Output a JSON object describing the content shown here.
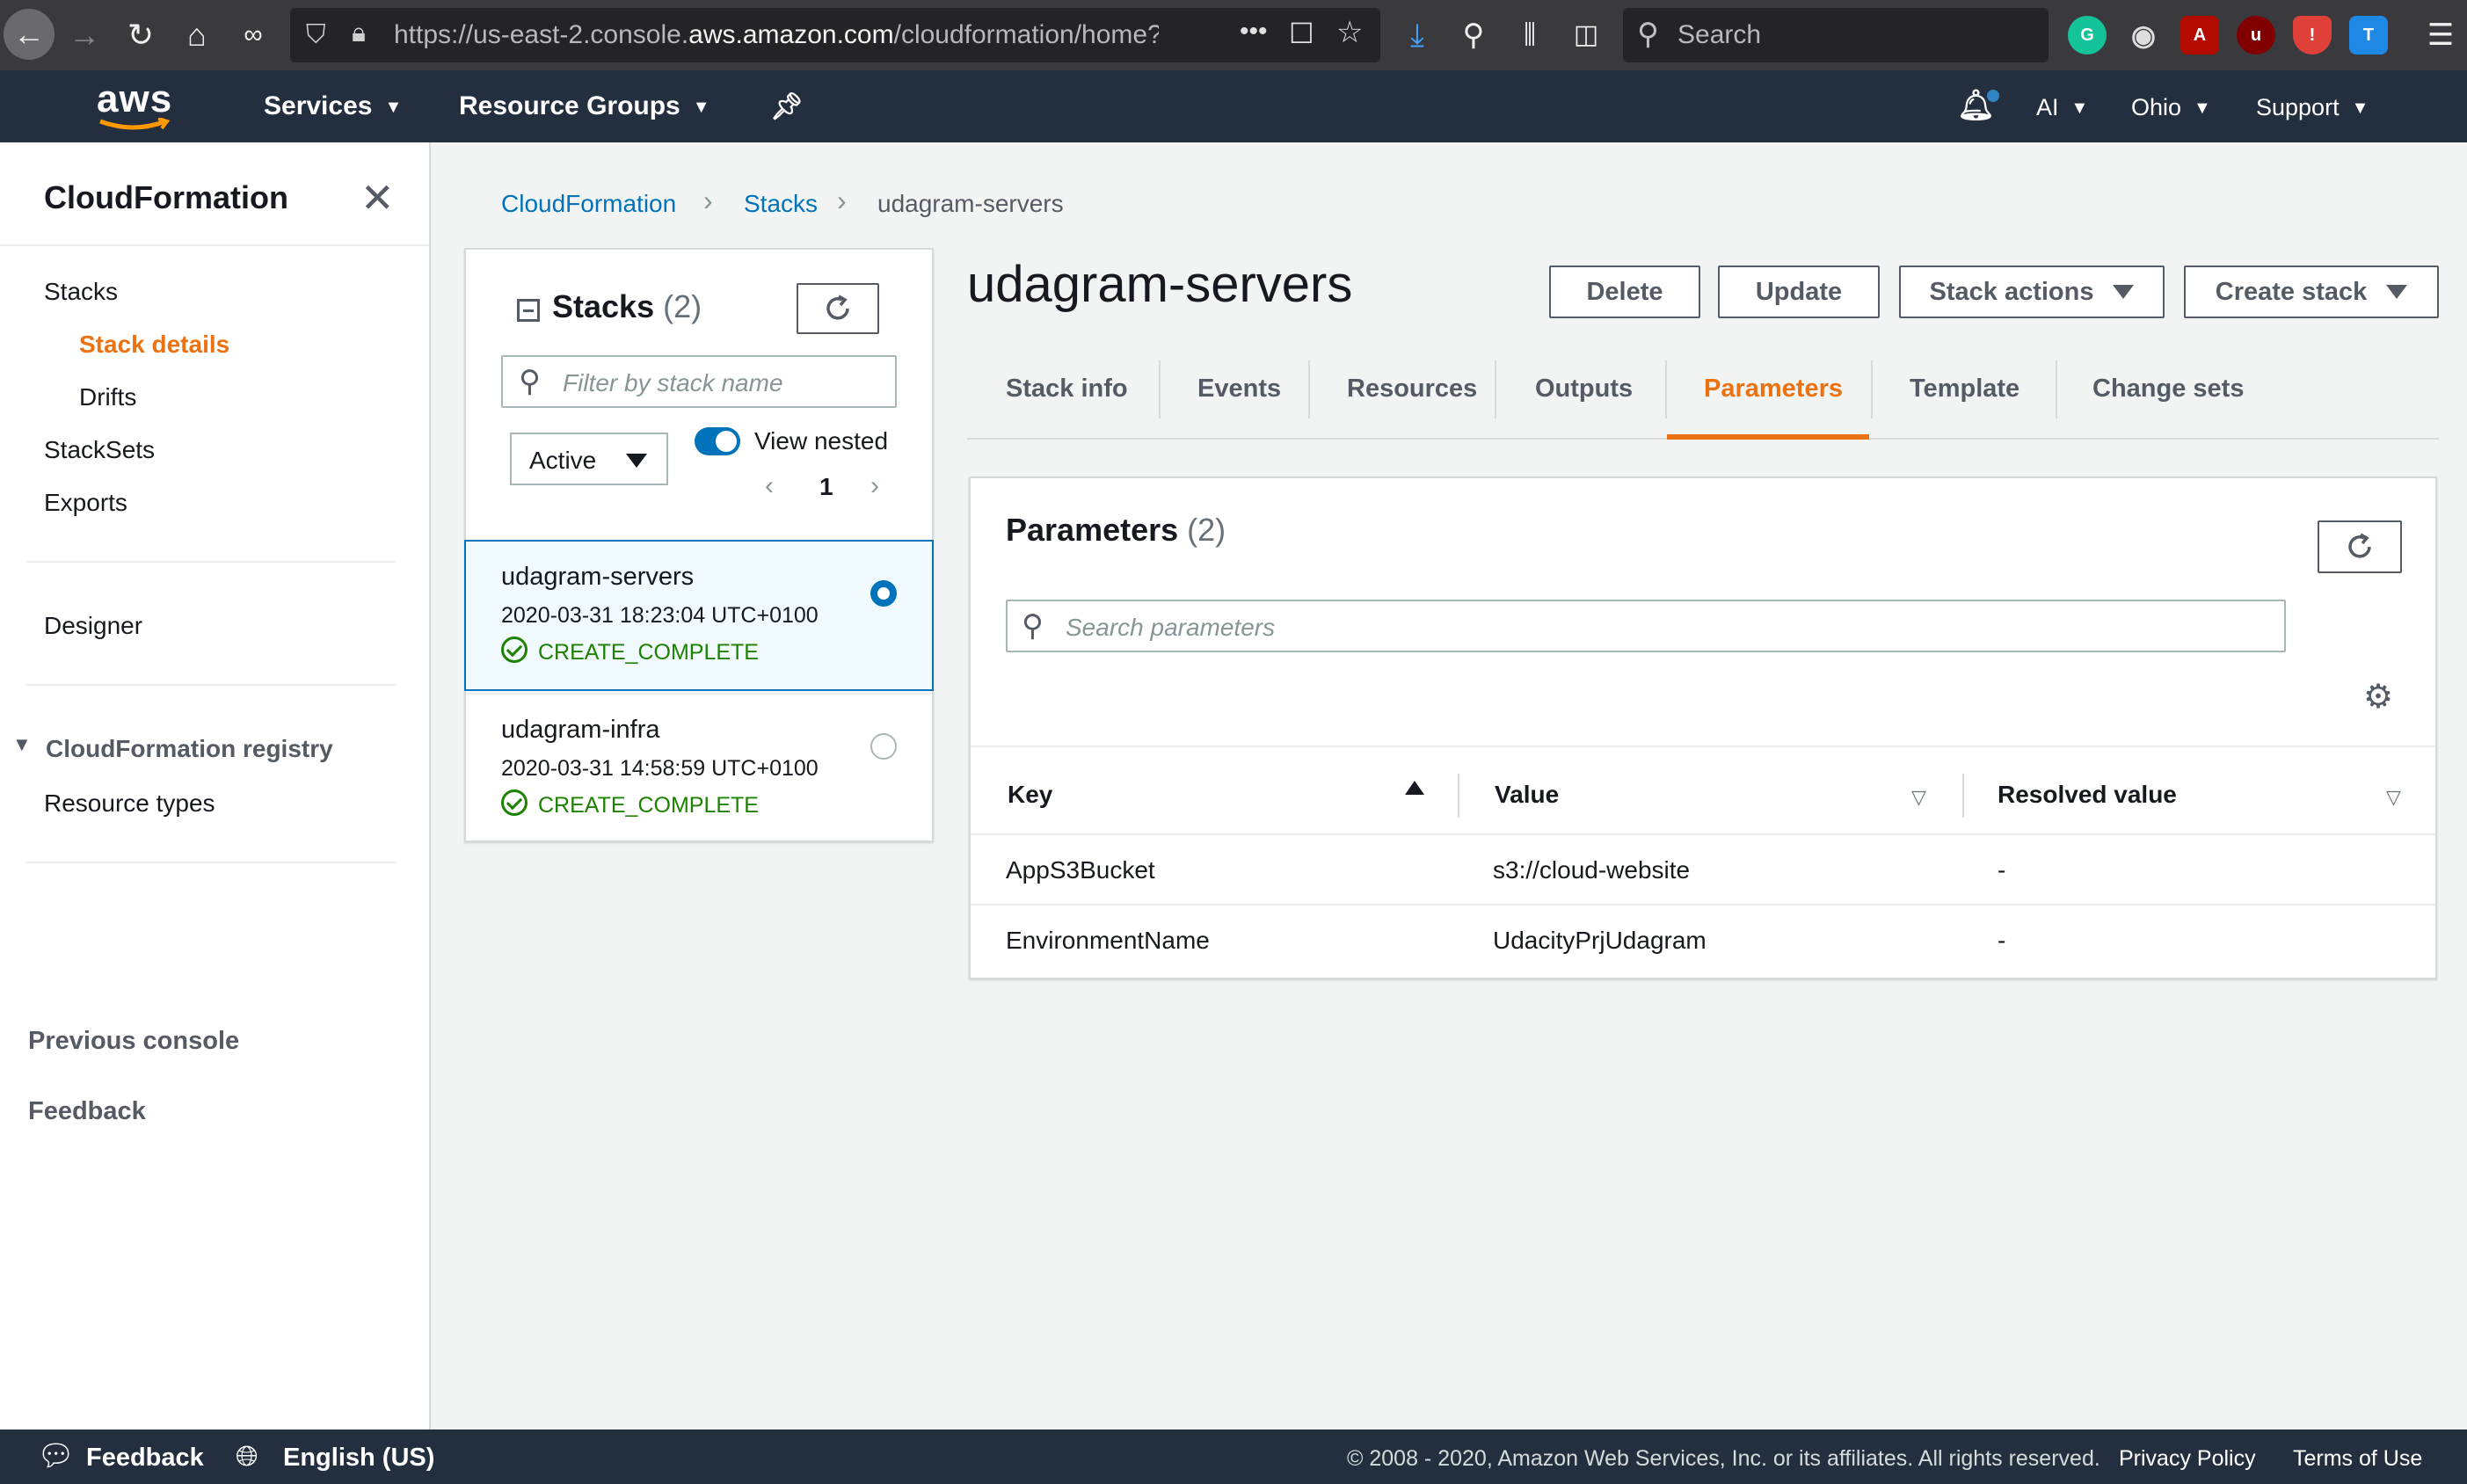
{
  "browser": {
    "url_prefix": "https://us-east-2.console.",
    "url_domain": "aws.amazon.com",
    "url_suffix": "/cloudformation/home?reg",
    "more": "•••",
    "search_placeholder": "Search",
    "extensions": [
      "grammarly-icon",
      "account-icon",
      "acrobat-icon",
      "ublock-icon",
      "shield-icon",
      "shirt-icon"
    ]
  },
  "aws_nav": {
    "logo": "aws",
    "services": "Services",
    "resource_groups": "Resource Groups",
    "account": "AI",
    "region": "Ohio",
    "support": "Support"
  },
  "sidebar": {
    "title": "CloudFormation",
    "items": [
      {
        "label": "Stacks"
      },
      {
        "label": "Stack details",
        "active": true
      },
      {
        "label": "Drifts"
      },
      {
        "label": "StackSets"
      },
      {
        "label": "Exports"
      },
      {
        "label": "Designer"
      },
      {
        "label": "CloudFormation registry"
      },
      {
        "label": "Resource types"
      }
    ],
    "previous_console": "Previous console",
    "feedback": "Feedback"
  },
  "breadcrumb": [
    "CloudFormation",
    "Stacks",
    "udagram-servers"
  ],
  "stacks_panel": {
    "title": "Stacks",
    "count": "(2)",
    "filter_placeholder": "Filter by stack name",
    "status_filter": "Active",
    "toggle_label": "View nested",
    "page": "1",
    "stacks": [
      {
        "name": "udagram-servers",
        "date": "2020-03-31 18:23:04 UTC+0100",
        "status": "CREATE_COMPLETE",
        "selected": true
      },
      {
        "name": "udagram-infra",
        "date": "2020-03-31 14:58:59 UTC+0100",
        "status": "CREATE_COMPLETE",
        "selected": false
      }
    ]
  },
  "stack": {
    "title": "udagram-servers",
    "actions": {
      "delete": "Delete",
      "update": "Update",
      "stack_actions": "Stack actions",
      "create_stack": "Create stack"
    },
    "tabs": [
      "Stack info",
      "Events",
      "Resources",
      "Outputs",
      "Parameters",
      "Template",
      "Change sets"
    ],
    "active_tab": "Parameters"
  },
  "parameters": {
    "title": "Parameters",
    "count": "(2)",
    "search_placeholder": "Search parameters",
    "columns": [
      "Key",
      "Value",
      "Resolved value"
    ],
    "rows": [
      {
        "key": "AppS3Bucket",
        "value": "s3://cloud-website",
        "resolved": "-"
      },
      {
        "key": "EnvironmentName",
        "value": "UdacityPrjUdagram",
        "resolved": "-"
      }
    ]
  },
  "footer": {
    "feedback": "Feedback",
    "language": "English (US)",
    "copyright": "© 2008 - 2020, Amazon Web Services, Inc. or its affiliates. All rights reserved.",
    "privacy": "Privacy Policy",
    "terms": "Terms of Use"
  },
  "colors": {
    "accent": "#ec7211",
    "link": "#0073bb",
    "success": "#1d8102",
    "nav_bg": "#232f3e"
  }
}
